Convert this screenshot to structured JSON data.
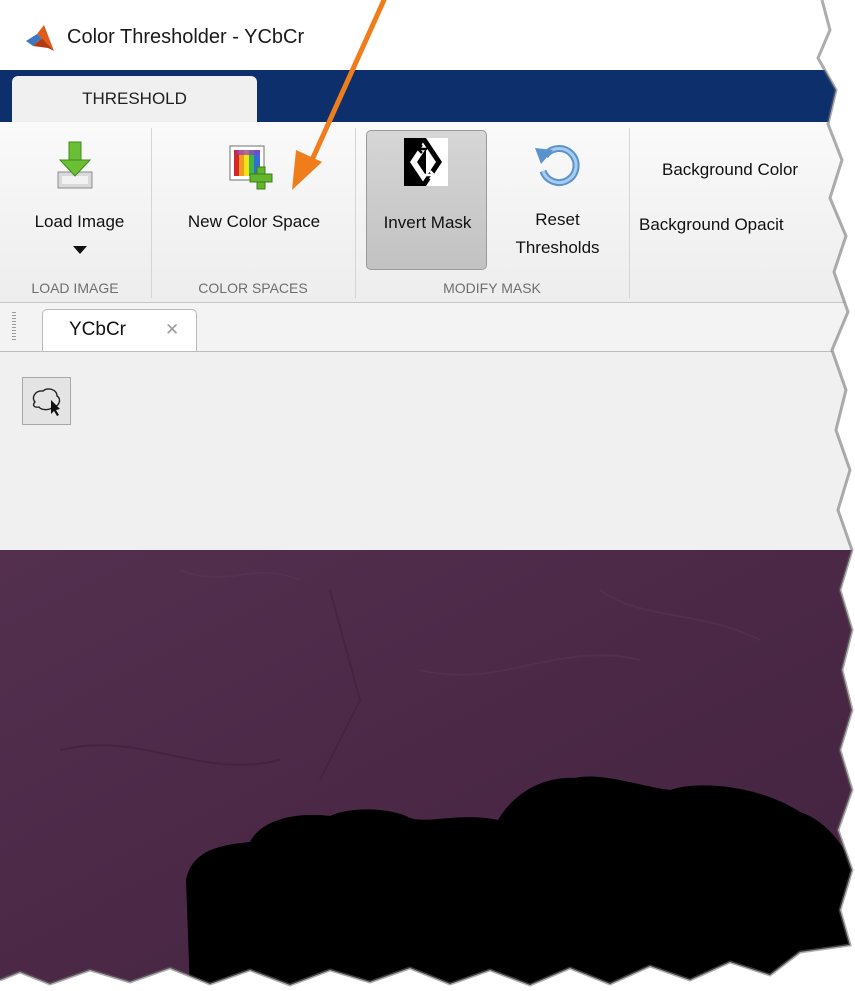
{
  "window": {
    "title": "Color Thresholder - YCbCr",
    "logo_icon": "matlab-logo-icon"
  },
  "ribbon": {
    "tab_label": "THRESHOLD",
    "buttons": {
      "load_image": "Load Image",
      "new_color_space": "New Color Space",
      "invert_mask": "Invert Mask",
      "reset_line1": "Reset",
      "reset_line2": "Thresholds"
    },
    "groups": {
      "load_image": "LOAD IMAGE",
      "color_spaces": "COLOR SPACES",
      "modify_mask": "MODIFY MASK"
    },
    "background_color_label": "Background Color",
    "background_opacity_label": "Background Opacit"
  },
  "document": {
    "tab_label": "YCbCr",
    "tab_close_icon": "close-icon",
    "tools": [
      "freehand-lasso-icon"
    ]
  },
  "colors": {
    "tab_strip": "#0d2f6b",
    "image_fill": "#4b2948",
    "mask": "#000000",
    "annotation_arrow": "#f07d1b"
  }
}
